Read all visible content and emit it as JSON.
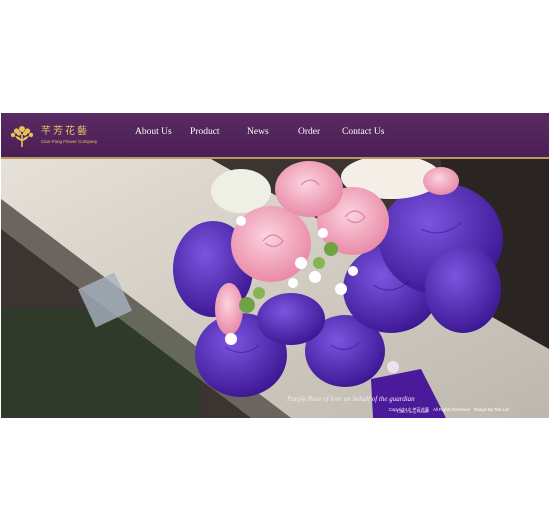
{
  "brand": {
    "name_zh": "芊芳花藝",
    "name_en": "Cian-Fang Flower Company"
  },
  "nav": {
    "items": [
      {
        "label": "About Us"
      },
      {
        "label": "Product"
      },
      {
        "label": "News"
      },
      {
        "label": "Order"
      },
      {
        "label": "Contact Us"
      }
    ]
  },
  "hero": {
    "caption": "Purple Rose of love on behalf of the guardian",
    "sub_caption": "Cian-Fang Flower"
  },
  "footer": {
    "copyright": "Copyright ©  芊芳花藝",
    "rights": "All Rights Reserved",
    "design": "Design By Toki.Lim"
  },
  "colors": {
    "nav_bg": "#4a1f55",
    "nav_border": "#b89a5a",
    "brand_gold": "#e6c15c",
    "rose_pink": "#f2a9c0",
    "lisianthus_purple": "#5a2fc0"
  }
}
